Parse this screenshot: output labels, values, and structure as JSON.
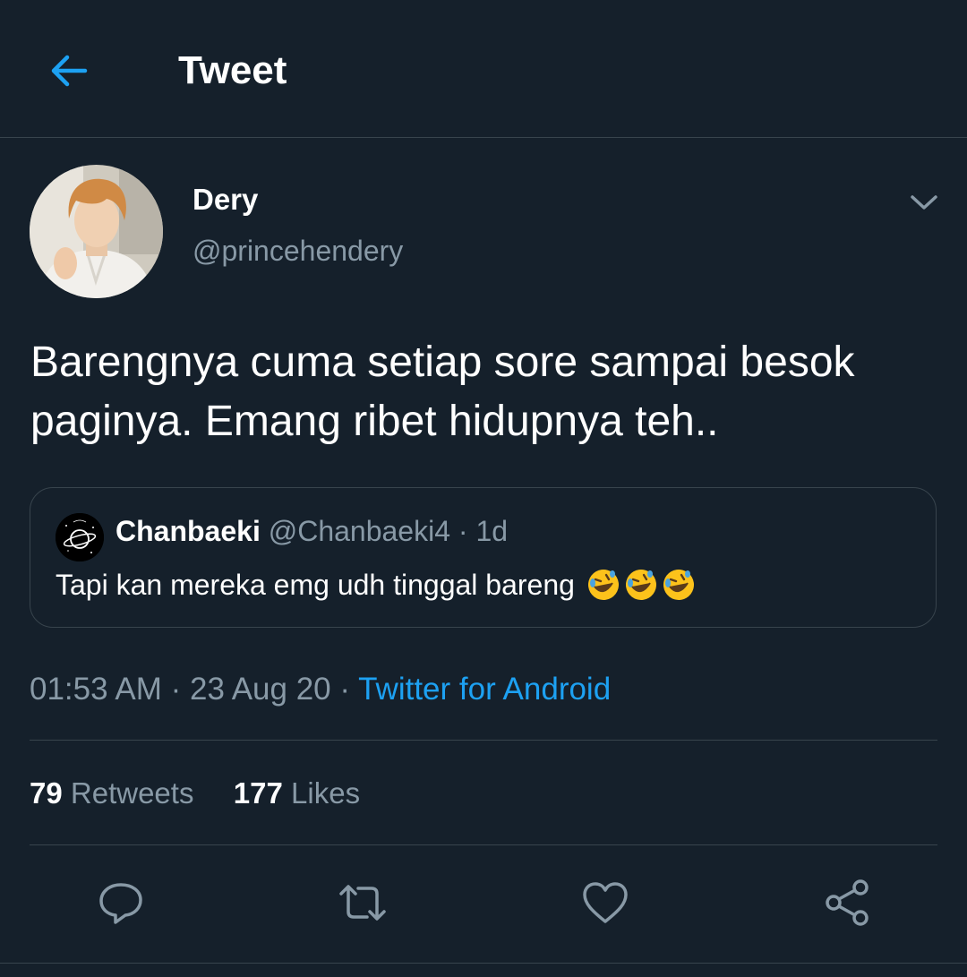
{
  "header": {
    "title": "Tweet",
    "back_icon": "arrow-left-icon"
  },
  "accent_color": "#1da1f2",
  "tweet": {
    "author": {
      "display_name": "Dery",
      "handle": "@princehendery"
    },
    "text": "Barengnya cuma setiap sore sampai besok paginya. Emang ribet hidupnya teh..",
    "quoted": {
      "display_name": "Chanbaeki",
      "handle": "@Chanbaeki4",
      "separator": "·",
      "time": "1d",
      "text": "Tapi kan mereka emg udh tinggal bareng",
      "emojis": [
        "rolling-on-floor-laughing",
        "rolling-on-floor-laughing",
        "rolling-on-floor-laughing"
      ]
    },
    "timestamp": "01:53 AM · 23 Aug 20 · ",
    "source": "Twitter for Android",
    "stats": {
      "retweets_count": "79",
      "retweets_label": "Retweets",
      "likes_count": "177",
      "likes_label": "Likes"
    },
    "actions": [
      "reply-icon",
      "retweet-icon",
      "like-icon",
      "share-icon"
    ]
  }
}
